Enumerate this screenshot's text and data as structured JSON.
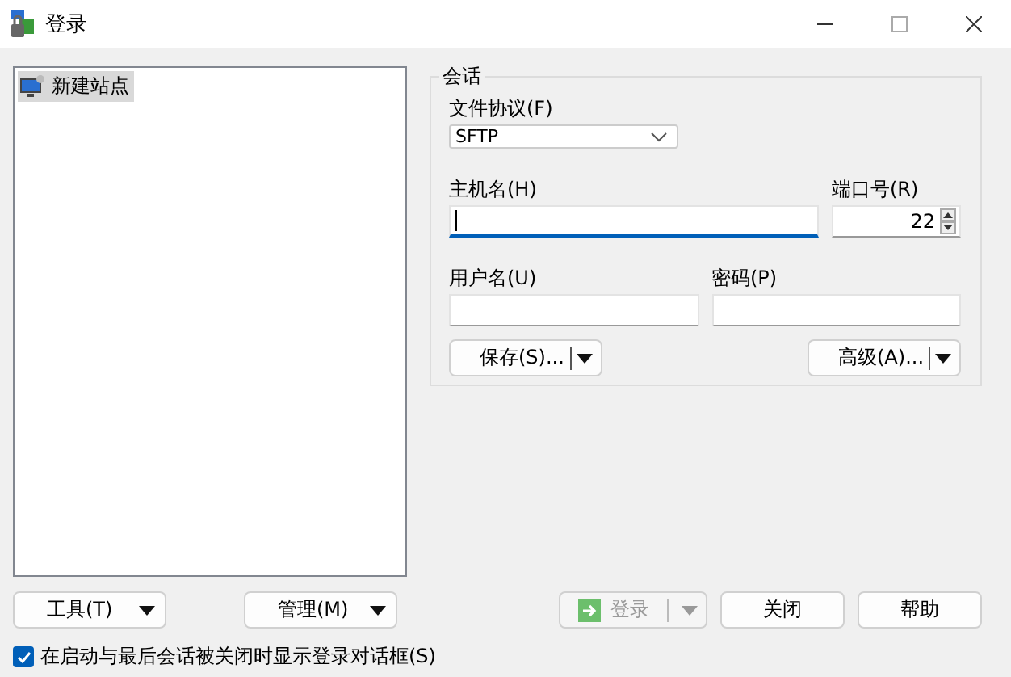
{
  "window": {
    "title": "登录"
  },
  "sites": [
    {
      "label": "新建站点",
      "selected": true
    }
  ],
  "session": {
    "title": "会话",
    "protocol_label": "文件协议(F)",
    "protocol": "SFTP",
    "host_label": "主机名(H)",
    "host_focused": true,
    "port_label": "端口号(R)",
    "port": "22",
    "user_label": "用户名(U)",
    "password_label": "密码(P)",
    "save_button": "保存(S)...",
    "advanced_button": "高级(A)..."
  },
  "left_buttons": [
    "工具(T)",
    "管理(M)"
  ],
  "login_button": {
    "label": "登录",
    "disabled": true
  },
  "buttons": [
    "关闭",
    "帮助"
  ],
  "show_on_startup": {
    "label": "在启动与最后会话被关闭时显示登录对话框(S)",
    "checked": true
  }
}
